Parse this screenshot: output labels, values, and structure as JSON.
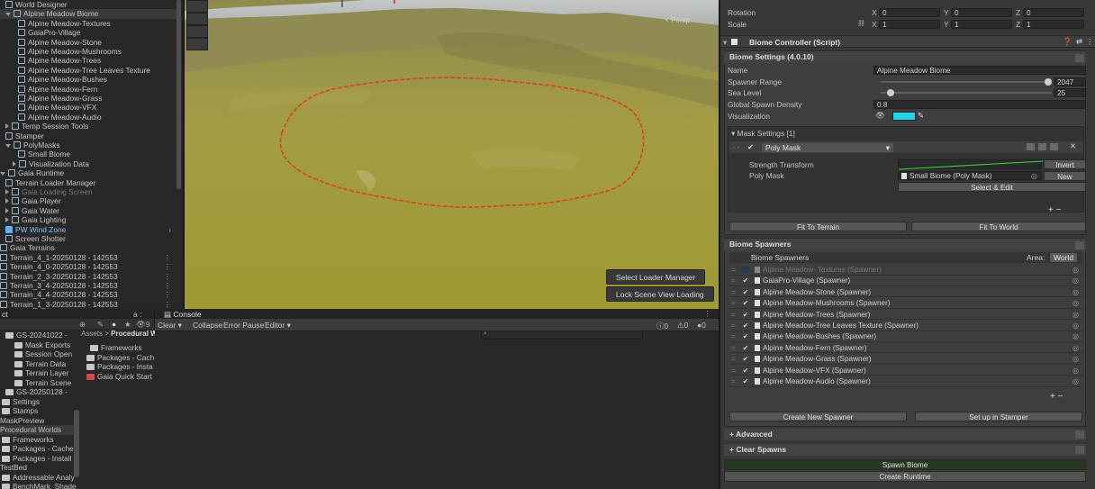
{
  "hierarchy": {
    "items": [
      {
        "label": "World Designer",
        "indent": 6
      },
      {
        "label": "Alpine Meadow Biome",
        "indent": 6
      },
      {
        "label": "Alpine Meadow-Textures",
        "indent": 20
      },
      {
        "label": "GaiaPro-Village",
        "indent": 20
      },
      {
        "label": "Alpine Meadow-Stone",
        "indent": 20
      },
      {
        "label": "Alpine Meadow-Mushrooms",
        "indent": 20
      },
      {
        "label": "Alpine Meadow-Trees",
        "indent": 20
      },
      {
        "label": "Alpine Meadow-Tree Leaves Texture",
        "indent": 20
      },
      {
        "label": "Alpine Meadow-Bushes",
        "indent": 20
      },
      {
        "label": "Alpine Meadow-Fern",
        "indent": 20
      },
      {
        "label": "Alpine Meadow-Grass",
        "indent": 20
      },
      {
        "label": "Alpine Meadow-VFX",
        "indent": 20
      },
      {
        "label": "Alpine Meadow-Audio",
        "indent": 20
      },
      {
        "label": "Temp Session Tools",
        "indent": 6
      },
      {
        "label": "Stamper",
        "indent": 6
      },
      {
        "label": "PolyMasks",
        "indent": 6
      },
      {
        "label": "Small Biome",
        "indent": 20
      },
      {
        "label": "Visualization Data",
        "indent": 14
      },
      {
        "label": "Gaia Runtime",
        "indent": 0
      },
      {
        "label": "Terrain Loader Manager",
        "indent": 6
      },
      {
        "label": "Gaia Loading Screen",
        "indent": 6
      },
      {
        "label": "Gaia Player",
        "indent": 6
      },
      {
        "label": "Gaia Water",
        "indent": 6
      },
      {
        "label": "Gaia Lighting",
        "indent": 6
      },
      {
        "label": "PW Wind Zone",
        "indent": 6
      },
      {
        "label": "Screen Shotter",
        "indent": 6
      },
      {
        "label": "Gaia Terrains",
        "indent": 0
      },
      {
        "label": "Terrain_4_1-20250128 - 142553",
        "indent": 0
      },
      {
        "label": "Terrain_4_0-20250128 - 142553",
        "indent": 0
      },
      {
        "label": "Terrain_2_3-20250128 - 142553",
        "indent": 0
      },
      {
        "label": "Terrain_3_4-20250128 - 142553",
        "indent": 0
      },
      {
        "label": "Terrain_4_4-20250128 - 142553",
        "indent": 0
      },
      {
        "label": "Terrain_1_3-20250128 - 142553",
        "indent": 0
      }
    ]
  },
  "scene": {
    "persp_label": "< Persp",
    "select_loader_button": "Select Loader Manager",
    "lock_scene_button": "Lock Scene View Loading"
  },
  "project": {
    "tab_label": "ct",
    "tab_icons": "a :",
    "hidden_count": "9",
    "left_items": [
      "GS-20241022 -",
      "Mask Exports",
      "Session Open",
      "Terrain Data",
      "Terrain Layer",
      "Terrain Scene",
      "GS-20250128 -",
      "Settings",
      "Stamps",
      "MaskPreview",
      "Procedural Worlds",
      "Frameworks",
      "Packages - Cache",
      "Packages - Install",
      "TestBed",
      "Addressable Analy",
      "BenchMark_Shade",
      "Data"
    ],
    "breadcrumb": [
      "Assets",
      "Procedural W"
    ],
    "asset_items": [
      "Frameworks",
      "Packages - Cach",
      "Packages - Insta",
      "Gaia Quick Start"
    ]
  },
  "console": {
    "tab_label": "Console",
    "clear_label": "Clear",
    "collapse_label": "Collapse",
    "error_pause_label": "Error Pause",
    "editor_label": "Editor",
    "count_info": "0",
    "count_warn": "0",
    "count_error": "0"
  },
  "inspector": {
    "rotation_label": "Rotation",
    "scale_label": "Scale",
    "rotation": {
      "x": "0",
      "y": "0",
      "z": "0"
    },
    "scale": {
      "x": "1",
      "y": "1",
      "z": "1"
    },
    "axis_x": "X",
    "axis_y": "Y",
    "axis_z": "Z",
    "component_title": "Biome Controller (Script)",
    "biome_settings_title": "Biome Settings  (4.0.10)",
    "name_label": "Name",
    "name_value": "Alpine Meadow Biome",
    "spawner_range_label": "Spawner Range",
    "spawner_range_value": "2047",
    "spawner_range_fraction": 1.0,
    "sea_level_label": "Sea Level",
    "sea_level_value": "25",
    "sea_level_fraction": 0.04,
    "density_label": "Global Spawn Density",
    "density_value": "0.8",
    "visualization_label": "Visualization",
    "visualization_color": "#22d3ee",
    "mask_settings_title": "Mask Settings [1]",
    "mask_type": "Poly Mask",
    "strength_label": "Strength Transform",
    "invert_button": "Invert",
    "poly_mask_label": "Poly Mask",
    "poly_mask_value": "Small Biome (Poly Mask)",
    "new_button": "New",
    "select_edit_button": "Select & Edit",
    "fit_terrain_button": "Fit To Terrain",
    "fit_world_button": "Fit To World",
    "biome_spawners_title": "Biome Spawners",
    "spawners_header": "Biome Spawners",
    "area_label": "Area:",
    "area_value": "World",
    "spawners": [
      {
        "label": "Alpine Meadow- Textures (Spawner)",
        "enabled": false
      },
      {
        "label": "GaiaPro-Village (Spawner)",
        "enabled": true
      },
      {
        "label": "Alpine Meadow-Stone (Spawner)",
        "enabled": true
      },
      {
        "label": "Alpine Meadow-Mushrooms (Spawner)",
        "enabled": true
      },
      {
        "label": "Alpine Meadow-Trees (Spawner)",
        "enabled": true
      },
      {
        "label": "Alpine Meadow-Tree Leaves Texture (Spawner)",
        "enabled": true
      },
      {
        "label": "Alpine Meadow-Bushes (Spawner)",
        "enabled": true
      },
      {
        "label": "Alpine Meadow-Fern (Spawner)",
        "enabled": true
      },
      {
        "label": "Alpine Meadow-Grass (Spawner)",
        "enabled": true
      },
      {
        "label": "Alpine Meadow-VFX (Spawner)",
        "enabled": true
      },
      {
        "label": "Alpine Meadow-Audio (Spawner)",
        "enabled": true
      }
    ],
    "plus_minus": "+  −",
    "create_spawner_button": "Create New Spawner",
    "setup_stamper_button": "Set up in Stamper",
    "advanced_label": "Advanced",
    "clear_spawns_label": "Clear Spawns",
    "spawn_biome_button": "Spawn Biome",
    "create_runtime_button": "Create Runtime",
    "help_icon": "?"
  }
}
